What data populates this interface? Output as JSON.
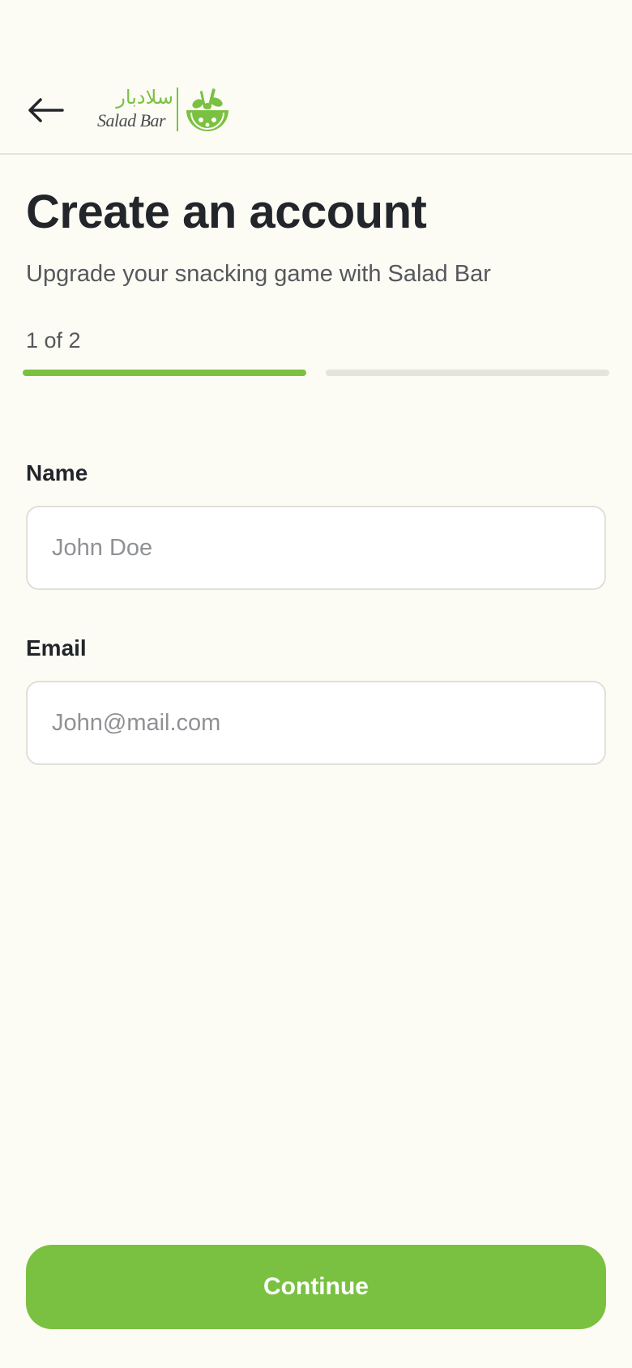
{
  "header": {
    "back_icon": "arrow-left-icon",
    "logo": {
      "arabic": "سلادبار",
      "latin": "Salad Bar",
      "mark_icon": "salad-bowl-icon"
    }
  },
  "main": {
    "title": "Create an account",
    "subtitle": "Upgrade your snacking game with Salad Bar",
    "step": {
      "label": "1 of 2",
      "current": 1,
      "total": 2
    }
  },
  "form": {
    "name": {
      "label": "Name",
      "value": "",
      "placeholder": "John Doe"
    },
    "email": {
      "label": "Email",
      "value": "",
      "placeholder": "John@mail.com"
    }
  },
  "footer": {
    "continue_label": "Continue"
  },
  "colors": {
    "accent": "#7ac142",
    "background": "#fdfcf4",
    "text": "#22252a",
    "muted_text": "#55585c",
    "inactive_track": "#e4e3dc"
  }
}
